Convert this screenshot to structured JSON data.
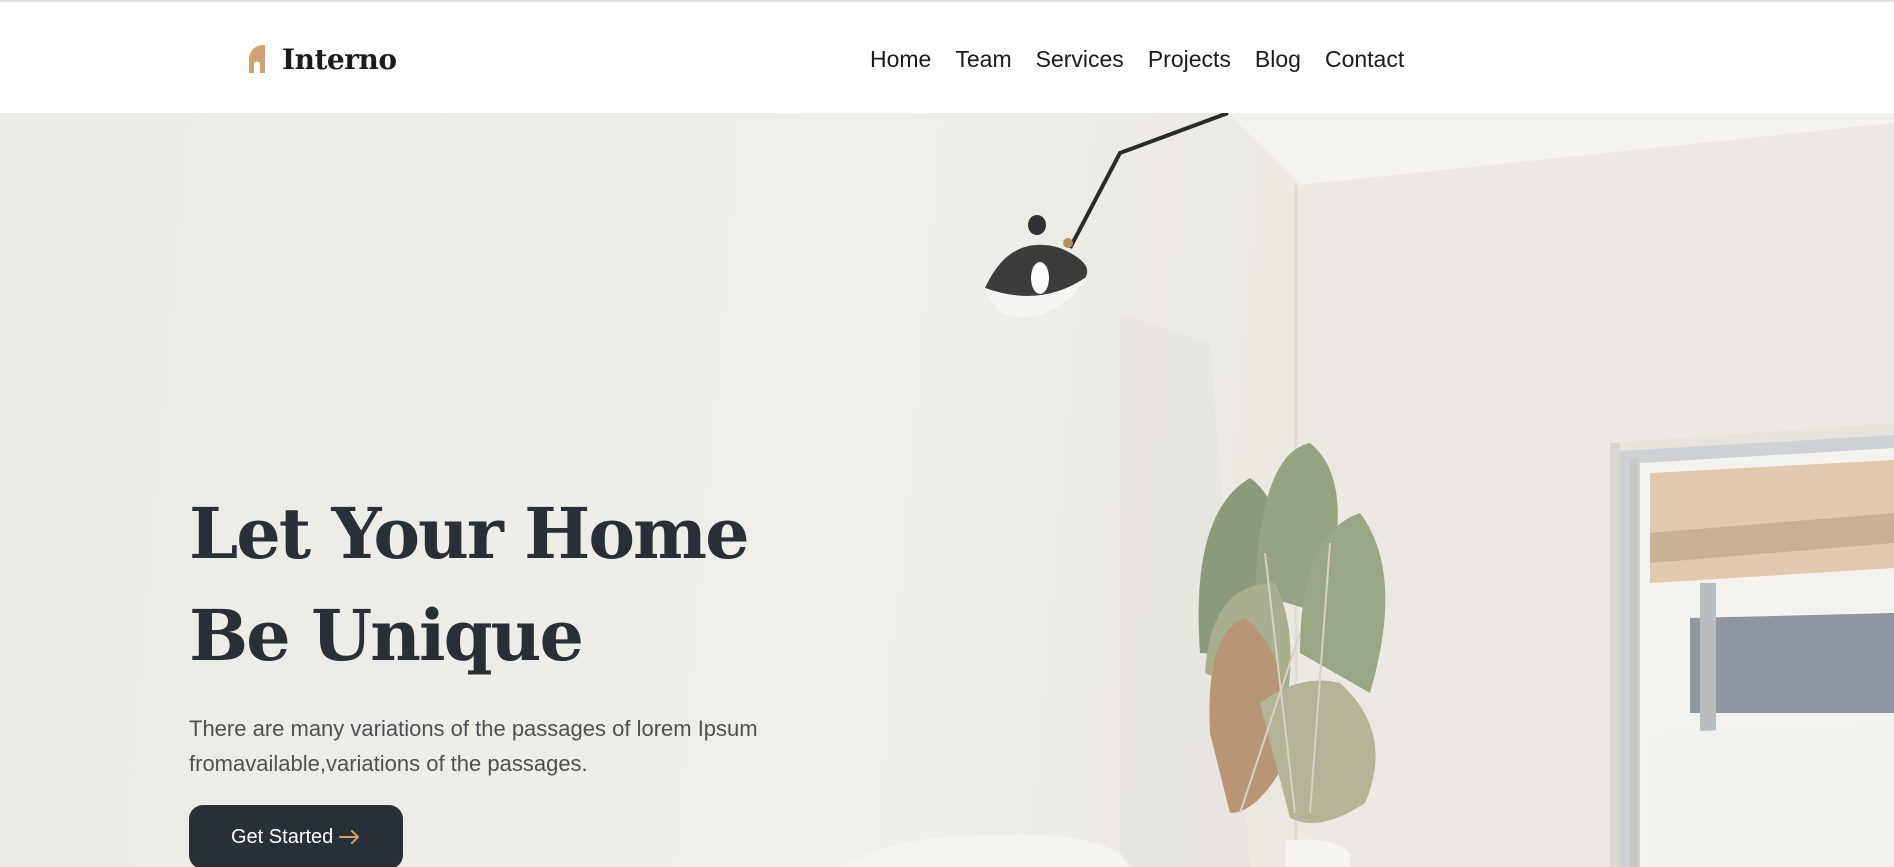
{
  "header": {
    "brand_name": "Interno",
    "brand_color": "#cda274",
    "nav": [
      {
        "label": "Home"
      },
      {
        "label": "Team"
      },
      {
        "label": "Services"
      },
      {
        "label": "Projects"
      },
      {
        "label": "Blog"
      },
      {
        "label": "Contact"
      }
    ]
  },
  "hero": {
    "title_line1": "Let Your Home",
    "title_line2": "Be Unique",
    "description": "There are many variations of the passages of lorem Ipsum fromavailable,variations of the passages.",
    "cta_label": "Get Started",
    "cta_icon": "arrow-right-icon",
    "cta_color": "#292f36",
    "title_color": "#292f36"
  }
}
